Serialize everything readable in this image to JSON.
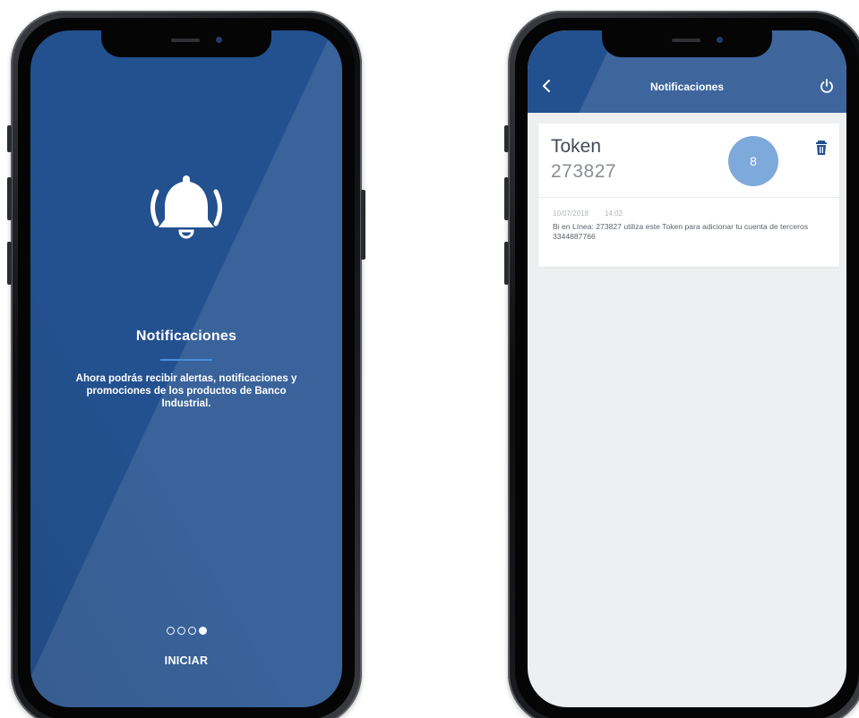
{
  "left_screen": {
    "icon": "bell-ringing-icon",
    "title": "Notificaciones",
    "description": "Ahora podrás recibir alertas, notificaciones y promociones de los productos de Banco Industrial.",
    "pagination": {
      "total": 4,
      "active": 4
    },
    "start_label": "INICIAR"
  },
  "right_screen": {
    "header": {
      "title": "Notificaciones",
      "back_icon": "chevron-left-icon",
      "power_icon": "power-icon"
    },
    "notification": {
      "title": "Token",
      "code": "273827",
      "badge": "8",
      "delete_icon": "trash-icon",
      "date": "10/07/2018",
      "time": "14:02",
      "message": "Bi en Línea: 273827 utiliza este Token para adicionar tu cuenta de terceros 3344887766"
    }
  },
  "colors": {
    "primary": "#23518f",
    "accent_line": "#4a8fdc",
    "badge": "#7ea9db",
    "list_background": "#eeeff1"
  }
}
